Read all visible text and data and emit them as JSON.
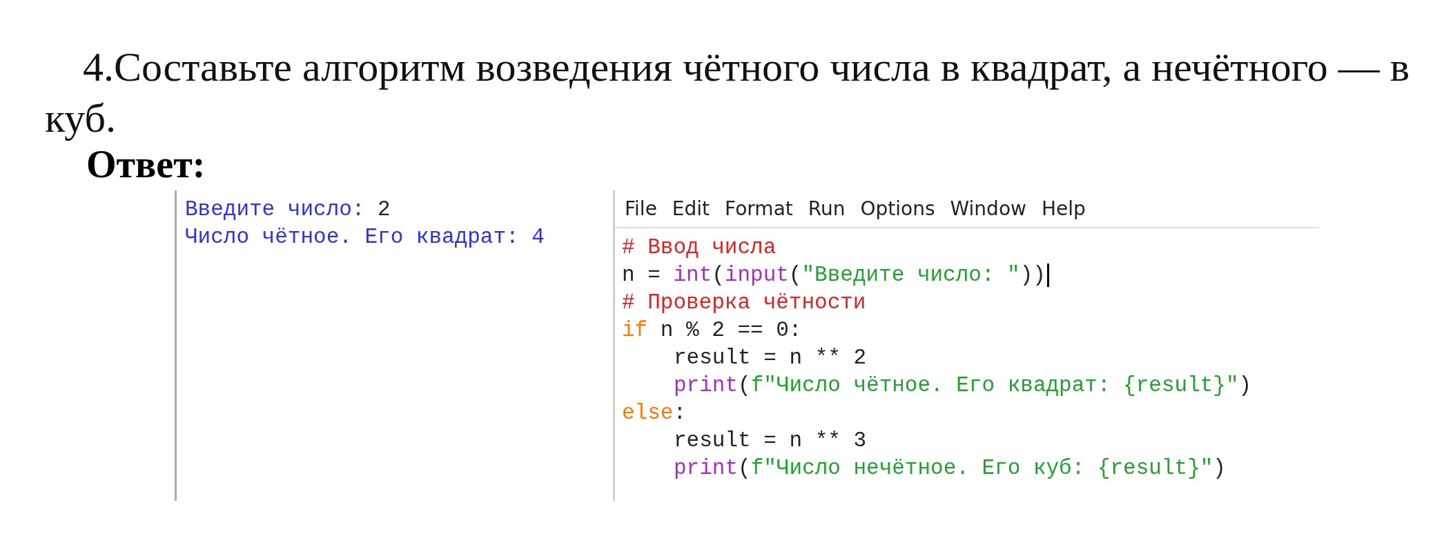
{
  "task": {
    "number": "4.",
    "text": "Составьте алгоритм возведения чётного числа в квадрат, а нечётного — в куб."
  },
  "answer_label": "Ответ:",
  "shell": {
    "lines": [
      [
        {
          "kind": "output",
          "text": "Введите число: "
        },
        {
          "kind": "input",
          "text": "2"
        }
      ],
      [
        {
          "kind": "output",
          "text": "Число чётное. Его квадрат: 4"
        }
      ]
    ]
  },
  "editor": {
    "menu": [
      "File",
      "Edit",
      "Format",
      "Run",
      "Options",
      "Window",
      "Help"
    ],
    "lines": [
      {
        "indented": false,
        "cursor": false,
        "tokens": [
          {
            "kind": "comment",
            "text": "# Ввод числа"
          }
        ]
      },
      {
        "indented": false,
        "cursor": true,
        "tokens": [
          {
            "kind": "plain",
            "text": "n = "
          },
          {
            "kind": "builtin",
            "text": "int"
          },
          {
            "kind": "plain",
            "text": "("
          },
          {
            "kind": "builtin",
            "text": "input"
          },
          {
            "kind": "plain",
            "text": "("
          },
          {
            "kind": "string",
            "text": "\"Введите число: \""
          },
          {
            "kind": "plain",
            "text": "))"
          }
        ]
      },
      {
        "indented": false,
        "cursor": false,
        "tokens": [
          {
            "kind": "comment",
            "text": "# Проверка чётности"
          }
        ]
      },
      {
        "indented": false,
        "cursor": false,
        "tokens": [
          {
            "kind": "keyword",
            "text": "if"
          },
          {
            "kind": "plain",
            "text": " n % 2 == 0:"
          }
        ]
      },
      {
        "indented": true,
        "cursor": false,
        "tokens": [
          {
            "kind": "plain",
            "text": "result = n ** 2"
          }
        ]
      },
      {
        "indented": true,
        "cursor": false,
        "tokens": [
          {
            "kind": "builtin",
            "text": "print"
          },
          {
            "kind": "plain",
            "text": "("
          },
          {
            "kind": "string",
            "text": "f\"Число чётное. Его квадрат: {result}\""
          },
          {
            "kind": "plain",
            "text": ")"
          }
        ]
      },
      {
        "indented": false,
        "cursor": false,
        "tokens": [
          {
            "kind": "keyword",
            "text": "else"
          },
          {
            "kind": "plain",
            "text": ":"
          }
        ]
      },
      {
        "indented": true,
        "cursor": false,
        "tokens": [
          {
            "kind": "plain",
            "text": "result = n ** 3"
          }
        ]
      },
      {
        "indented": true,
        "cursor": false,
        "tokens": [
          {
            "kind": "builtin",
            "text": "print"
          },
          {
            "kind": "plain",
            "text": "("
          },
          {
            "kind": "string",
            "text": "f\"Число нечётное. Его куб: {result}\""
          },
          {
            "kind": "plain",
            "text": ")"
          }
        ]
      }
    ]
  }
}
